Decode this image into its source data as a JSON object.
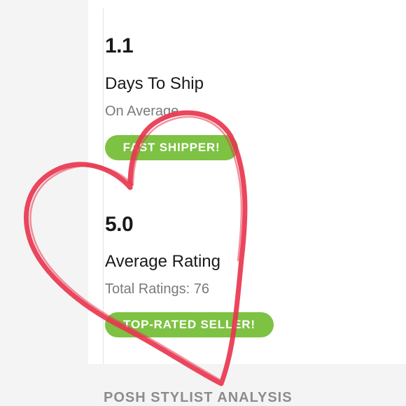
{
  "shipping": {
    "value": "1.1",
    "label": "Days To Ship",
    "sub": "On Average",
    "badge": "FAST SHIPPER!"
  },
  "rating": {
    "value": "5.0",
    "label": "Average Rating",
    "sub": "Total Ratings: 76",
    "badge": "TOP-RATED SELLER!"
  },
  "section": {
    "title": "POSH STYLIST ANALYSIS"
  },
  "colors": {
    "badge": "#7dc242",
    "heart": "#e8364f",
    "background": "#f4f4f4",
    "card": "#ffffff"
  },
  "overlay": {
    "icon": "heart-icon"
  }
}
